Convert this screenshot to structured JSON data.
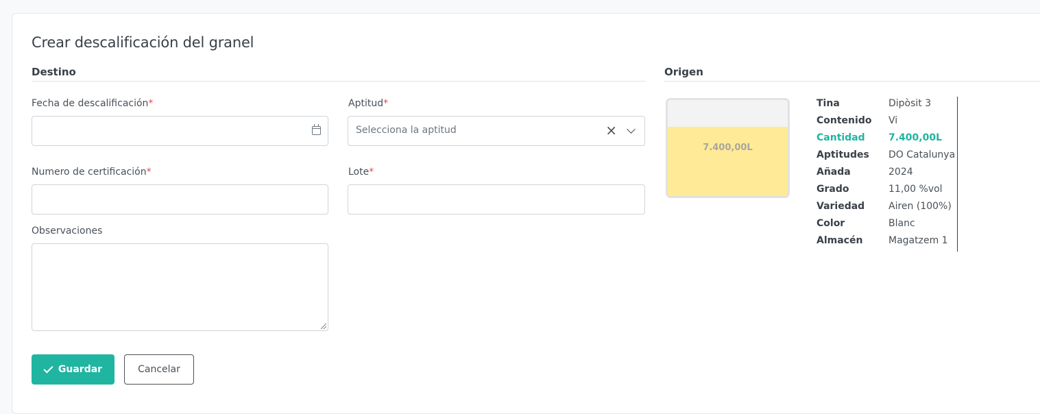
{
  "page": {
    "title": "Crear descalificación del granel"
  },
  "destino": {
    "heading": "Destino",
    "fecha": {
      "label": "Fecha de descalificación",
      "required": "*",
      "value": ""
    },
    "aptitud": {
      "label": "Aptitud",
      "required": "*",
      "placeholder": "Selecciona la aptitud",
      "clear_icon": "close-icon",
      "dropdown_icon": "chevron-down-icon"
    },
    "certificacion": {
      "label": "Numero de certificación",
      "required": "*",
      "value": ""
    },
    "lote": {
      "label": "Lote",
      "required": "*",
      "value": ""
    },
    "observaciones": {
      "label": "Observaciones",
      "value": ""
    }
  },
  "actions": {
    "save_label": "Guardar",
    "cancel_label": "Cancelar",
    "save_icon": "check-icon"
  },
  "origen": {
    "heading": "Origen",
    "tank": {
      "label": "7.400,00L",
      "fill_fraction": 0.72
    },
    "details": [
      {
        "key": "Tina",
        "value": "Dipòsit 3"
      },
      {
        "key": "Contenido",
        "value": "Vi"
      },
      {
        "key": "Cantidad",
        "value": "7.400,00L",
        "accent": true
      },
      {
        "key": "Aptitudes",
        "value": "DO Catalunya"
      },
      {
        "key": "Añada",
        "value": "2024"
      },
      {
        "key": "Grado",
        "value": "11,00 %vol"
      },
      {
        "key": "Variedad",
        "value": "Airen (100%)"
      },
      {
        "key": "Color",
        "value": "Blanc"
      },
      {
        "key": "Almacén",
        "value": "Magatzem 1"
      }
    ]
  },
  "colors": {
    "primary": "#1fb5a0",
    "required": "#e5484d",
    "tank_fill": "#ffea97",
    "tank_empty": "#f3f3f3"
  }
}
